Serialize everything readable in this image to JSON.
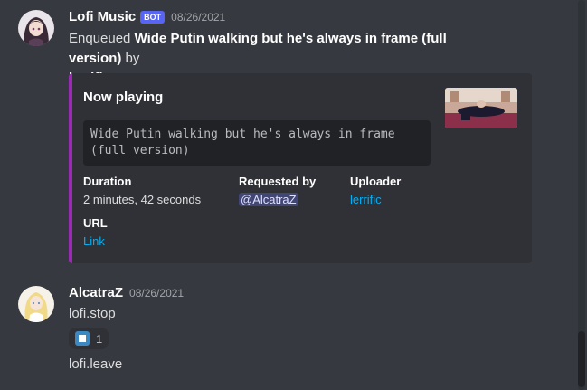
{
  "messages": [
    {
      "author": "Lofi Music",
      "bot_tag": "BOT",
      "timestamp": "08/26/2021",
      "avatar_icon": "anime-girl-avatar-icon",
      "text_prefix": "Enqueued ",
      "text_bold": "Wide Putin walking but he's always in frame (full version)",
      "text_suffix": " by",
      "text_author": "lerrific",
      "embed": {
        "accent_color": "#9b2bb4",
        "title": "Now playing",
        "code_line1": "Wide Putin walking but he's always in frame",
        "code_line2": "(full version)",
        "thumbnail_icon": "video-thumbnail-icon",
        "fields": {
          "duration_name": "Duration",
          "duration_value": "2 minutes, 42 seconds",
          "requested_name": "Requested by",
          "requested_value": "@AlcatraZ",
          "uploader_name": "Uploader",
          "uploader_value": "lerrific",
          "url_name": "URL",
          "url_value": "Link"
        }
      }
    },
    {
      "author": "AlcatraZ",
      "timestamp": "08/26/2021",
      "avatar_icon": "blonde-girl-avatar-icon",
      "lines": [
        "lofi.stop",
        "lofi.leave"
      ],
      "reaction": {
        "icon": "stop-button-icon",
        "count": "1"
      }
    }
  ],
  "colors": {
    "background": "#36393f",
    "embed_background": "#2f3136",
    "link": "#00aff4",
    "bot_tag": "#5865f2",
    "mention_bg": "#414675"
  }
}
